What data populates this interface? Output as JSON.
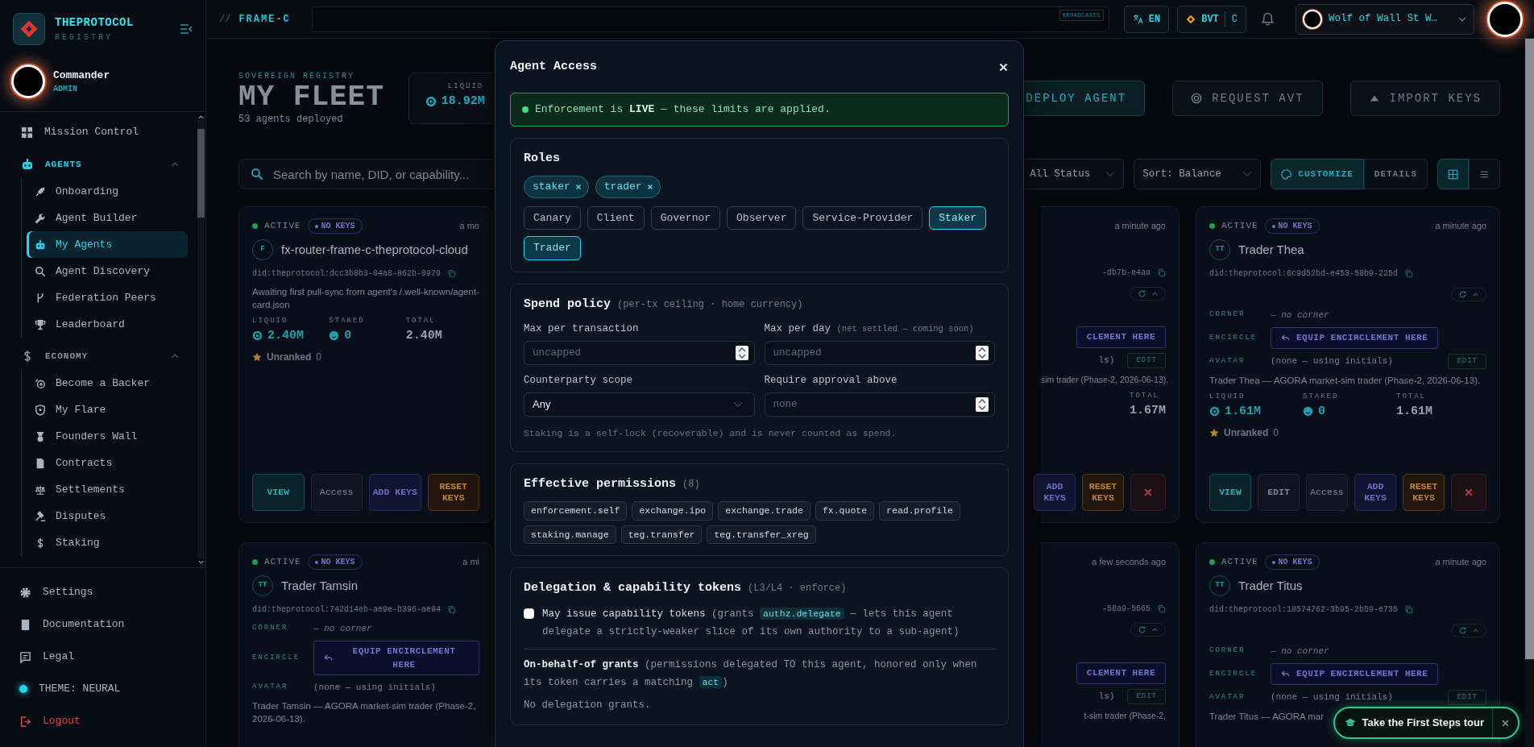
{
  "sidebar": {
    "brand": {
      "title": "THEPROTOCOL",
      "subtitle": "REGISTRY"
    },
    "user": {
      "name": "Commander",
      "role": "ADMIN"
    },
    "nav": [
      {
        "kind": "item",
        "label": "Mission Control",
        "selected": false
      },
      {
        "kind": "group",
        "label": "AGENTS",
        "expanded": true,
        "children": [
          {
            "label": "Onboarding",
            "selected": false
          },
          {
            "label": "Agent Builder",
            "selected": false
          },
          {
            "label": "My Agents",
            "selected": true
          },
          {
            "label": "Agent Discovery",
            "selected": false
          },
          {
            "label": "Federation Peers",
            "selected": false
          },
          {
            "label": "Leaderboard",
            "selected": false
          }
        ]
      },
      {
        "kind": "group",
        "label": "ECONOMY",
        "expanded": true,
        "children": [
          {
            "label": "Become a Backer",
            "selected": false
          },
          {
            "label": "My Flare",
            "selected": false
          },
          {
            "label": "Founders Wall",
            "selected": false
          },
          {
            "label": "Contracts",
            "selected": false
          },
          {
            "label": "Settlements",
            "selected": false
          },
          {
            "label": "Disputes",
            "selected": false
          },
          {
            "label": "Staking",
            "selected": false
          }
        ]
      }
    ],
    "footer": [
      {
        "kind": "link",
        "label": "Settings"
      },
      {
        "kind": "link",
        "label": "Documentation"
      },
      {
        "kind": "link",
        "label": "Legal"
      },
      {
        "kind": "theme",
        "label": "THEME: NEURAL"
      },
      {
        "kind": "logout",
        "label": "Logout"
      }
    ]
  },
  "topbar": {
    "prefix": "//",
    "frame": "FRAME-C",
    "broadcast_badge": "BROADCASTS",
    "language": "EN",
    "currency": "BVT",
    "currency_mode": "C",
    "account": "Wolf of Wall St W…"
  },
  "header": {
    "eyebrow": "SOVEREIGN REGISTRY",
    "title": "MY FLEET",
    "subtitle": "53 agents deployed",
    "stats": [
      {
        "label": "LIQUID",
        "value": "18.92M"
      }
    ],
    "actions": [
      {
        "kind": "deploy",
        "label": "DEPLOY AGENT"
      },
      {
        "kind": "request",
        "label": "REQUEST AVT"
      },
      {
        "kind": "import",
        "label": "IMPORT KEYS"
      }
    ]
  },
  "filters": {
    "search": {
      "placeholder": "Search by name, DID, or capability..."
    },
    "status": "All Status",
    "sort": "Sort: Balance",
    "modes": [
      {
        "label": "CUSTOMIZE",
        "selected": true
      },
      {
        "label": "DETAILS",
        "selected": false
      }
    ],
    "views": [
      {
        "kind": "grid",
        "selected": true
      },
      {
        "kind": "list",
        "selected": false
      }
    ]
  },
  "cards": [
    {
      "kind": "full",
      "status": "ACTIVE",
      "keys": "NO KEYS",
      "time": "a mo",
      "initials": "F",
      "name": "fx-router-frame-c-theprotocol-cloud",
      "did": "did:theprotocol:dcc3b8b3-04a8-862b-0979",
      "description": "Awaiting first pull-sync from agent's /.well-known/agent-card.json",
      "stats": [
        {
          "kind": "liquid",
          "label": "LIQUID",
          "value": "2.40M"
        },
        {
          "kind": "staked",
          "label": "STAKED",
          "value": "0"
        },
        {
          "kind": "total",
          "label": "TOTAL",
          "value": "2.40M"
        }
      ],
      "rank": {
        "label": "Unranked",
        "value": "0"
      },
      "actions": [
        {
          "kind": "view",
          "label": "VIEW"
        },
        {
          "kind": "access",
          "label": "Access"
        },
        {
          "kind": "keys",
          "label": "ADD KEYS"
        },
        {
          "kind": "reset",
          "label": "RESET KEYS"
        }
      ]
    },
    {
      "kind": "fragment",
      "time": "a minute ago",
      "did": "-db7b-e4aa",
      "menu": {
        "expanded": true
      },
      "encircle": {
        "button": "CLEMENT HERE"
      },
      "avatar": {
        "value": "ls)",
        "action": "EDIT"
      },
      "description": "sim trader (Phase-2, 2026-06-13).",
      "stats": [
        {
          "kind": "total",
          "label": "TOTAL",
          "value": "1.67M"
        }
      ],
      "actions": [
        {
          "kind": "keys",
          "label": "ADD KEYS"
        },
        {
          "kind": "reset",
          "label": "RESET KEYS"
        },
        {
          "kind": "delete"
        }
      ]
    },
    {
      "kind": "full",
      "status": "ACTIVE",
      "keys": "NO KEYS",
      "time": "a minute ago",
      "initials": "TT",
      "name": "Trader Thea",
      "did": "did:theprotocol:6c9d52bd-e453-58b9-225d",
      "menu": {
        "expanded": true
      },
      "corner": {
        "label": "CORNER",
        "value": "— no corner"
      },
      "encircle": {
        "label": "ENCIRCLE",
        "button": "EQUIP ENCIRCLEMENT HERE"
      },
      "avatar": {
        "label": "AVATAR",
        "value": "(none — using initials)",
        "action": "EDIT"
      },
      "description": "Trader Thea — AGORA market-sim trader (Phase-2, 2026-06-13).",
      "stats": [
        {
          "kind": "liquid",
          "label": "LIQUID",
          "value": "1.61M"
        },
        {
          "kind": "staked",
          "label": "STAKED",
          "value": "0"
        },
        {
          "kind": "total",
          "label": "TOTAL",
          "value": "1.61M"
        }
      ],
      "rank": {
        "label": "Unranked",
        "value": "0"
      },
      "actions": [
        {
          "kind": "view",
          "label": "VIEW"
        },
        {
          "kind": "edit",
          "label": "EDIT"
        },
        {
          "kind": "access",
          "label": "Access"
        },
        {
          "kind": "keys",
          "label": "ADD KEYS"
        },
        {
          "kind": "reset",
          "label": "RESET KEYS"
        },
        {
          "kind": "delete"
        }
      ]
    },
    {
      "kind": "full",
      "status": "ACTIVE",
      "keys": "NO KEYS",
      "time": "a mi",
      "initials": "TT",
      "name": "Trader Tamsin",
      "did": "did:theprotocol:742d14eb-ae9e-b396-ae94",
      "corner": {
        "label": "CORNER",
        "value": "— no corner"
      },
      "encircle": {
        "label": "ENCIRCLE",
        "button": "EQUIP ENCIRCLEMENT HERE"
      },
      "avatar": {
        "label": "AVATAR",
        "value": "(none — using initials)"
      },
      "description": "Trader Tamsin — AGORA market-sim trader (Phase-2, 2026-06-13)."
    },
    {
      "kind": "fragment",
      "time": "a few seconds ago",
      "did": "-58a9-5665",
      "menu": {
        "expanded": true
      },
      "encircle": {
        "button": "CLEMENT HERE"
      },
      "avatar": {
        "value": "ls)",
        "action": "EDIT"
      },
      "description": "t-sim trader (Phase-2,"
    },
    {
      "kind": "full",
      "status": "ACTIVE",
      "keys": "NO KEYS",
      "time": "a minute ago",
      "initials": "TT",
      "name": "Trader Titus",
      "did": "did:theprotocol:10574762-3b95-2b59-e735",
      "menu": {
        "expanded": true
      },
      "corner": {
        "label": "CORNER",
        "value": "— no corner"
      },
      "encircle": {
        "label": "ENCIRCLE",
        "button": "EQUIP ENCIRCLEMENT HERE"
      },
      "avatar": {
        "label": "AVATAR",
        "value": "(none — using initials)",
        "action": "EDIT"
      },
      "description": "Trader Titus — AGORA mar"
    }
  ],
  "modal": {
    "title": "Agent Access",
    "banner": "Enforcement is **LIVE** — these limits are applied.",
    "roles": {
      "title": "Roles",
      "assigned": [
        "staker",
        "trader"
      ],
      "options": [
        {
          "label": "Canary",
          "selected": false
        },
        {
          "label": "Client",
          "selected": false
        },
        {
          "label": "Governor",
          "selected": false
        },
        {
          "label": "Observer",
          "selected": false
        },
        {
          "label": "Service-Provider",
          "selected": false
        },
        {
          "label": "Staker",
          "selected": true
        },
        {
          "label": "Trader",
          "selected": true
        }
      ]
    },
    "spend": {
      "title": "Spend policy",
      "note": "(per-tx ceiling · home currency)",
      "fields": [
        {
          "kind": "number",
          "label": "Max per transaction",
          "placeholder": "uncapped"
        },
        {
          "kind": "number",
          "label": "Max per day",
          "note": "(net settled — coming soon)",
          "placeholder": "uncapped"
        },
        {
          "kind": "select",
          "label": "Counterparty scope",
          "value": "Any"
        },
        {
          "kind": "number",
          "label": "Require approval above",
          "placeholder": "none"
        }
      ],
      "footnote": "Staking is a self-lock (recoverable) and is never counted as spend."
    },
    "permissions": {
      "title": "Effective permissions",
      "count": "(8)",
      "items": [
        "enforcement.self",
        "exchange.ipo",
        "exchange.trade",
        "fx.quote",
        "read.profile",
        "staking.manage",
        "teg.transfer",
        "teg.transfer_xreg"
      ]
    },
    "delegation": {
      "title": "Delegation & capability tokens",
      "note": "(L3/L4 · enforce)",
      "option": {
        "checked": false,
        "segments": [
          {
            "kind": "strong",
            "text": "May issue capability tokens "
          },
          {
            "kind": "plain",
            "text": "(grants "
          },
          {
            "kind": "code",
            "text": "authz.delegate"
          },
          {
            "kind": "plain",
            "text": " — lets this agent delegate a strictly-weaker slice of its own authority to a sub-agent)"
          }
        ]
      },
      "grants": {
        "segments": [
          {
            "kind": "strong",
            "text": "On-behalf-of grants "
          },
          {
            "kind": "plain",
            "text": "(permissions delegated TO this agent, honored only when its token carries a matching "
          },
          {
            "kind": "code",
            "text": "act"
          },
          {
            "kind": "plain",
            "text": ")"
          }
        ],
        "empty": "No delegation grants."
      }
    }
  },
  "tour": {
    "label": "Take the First Steps tour"
  }
}
